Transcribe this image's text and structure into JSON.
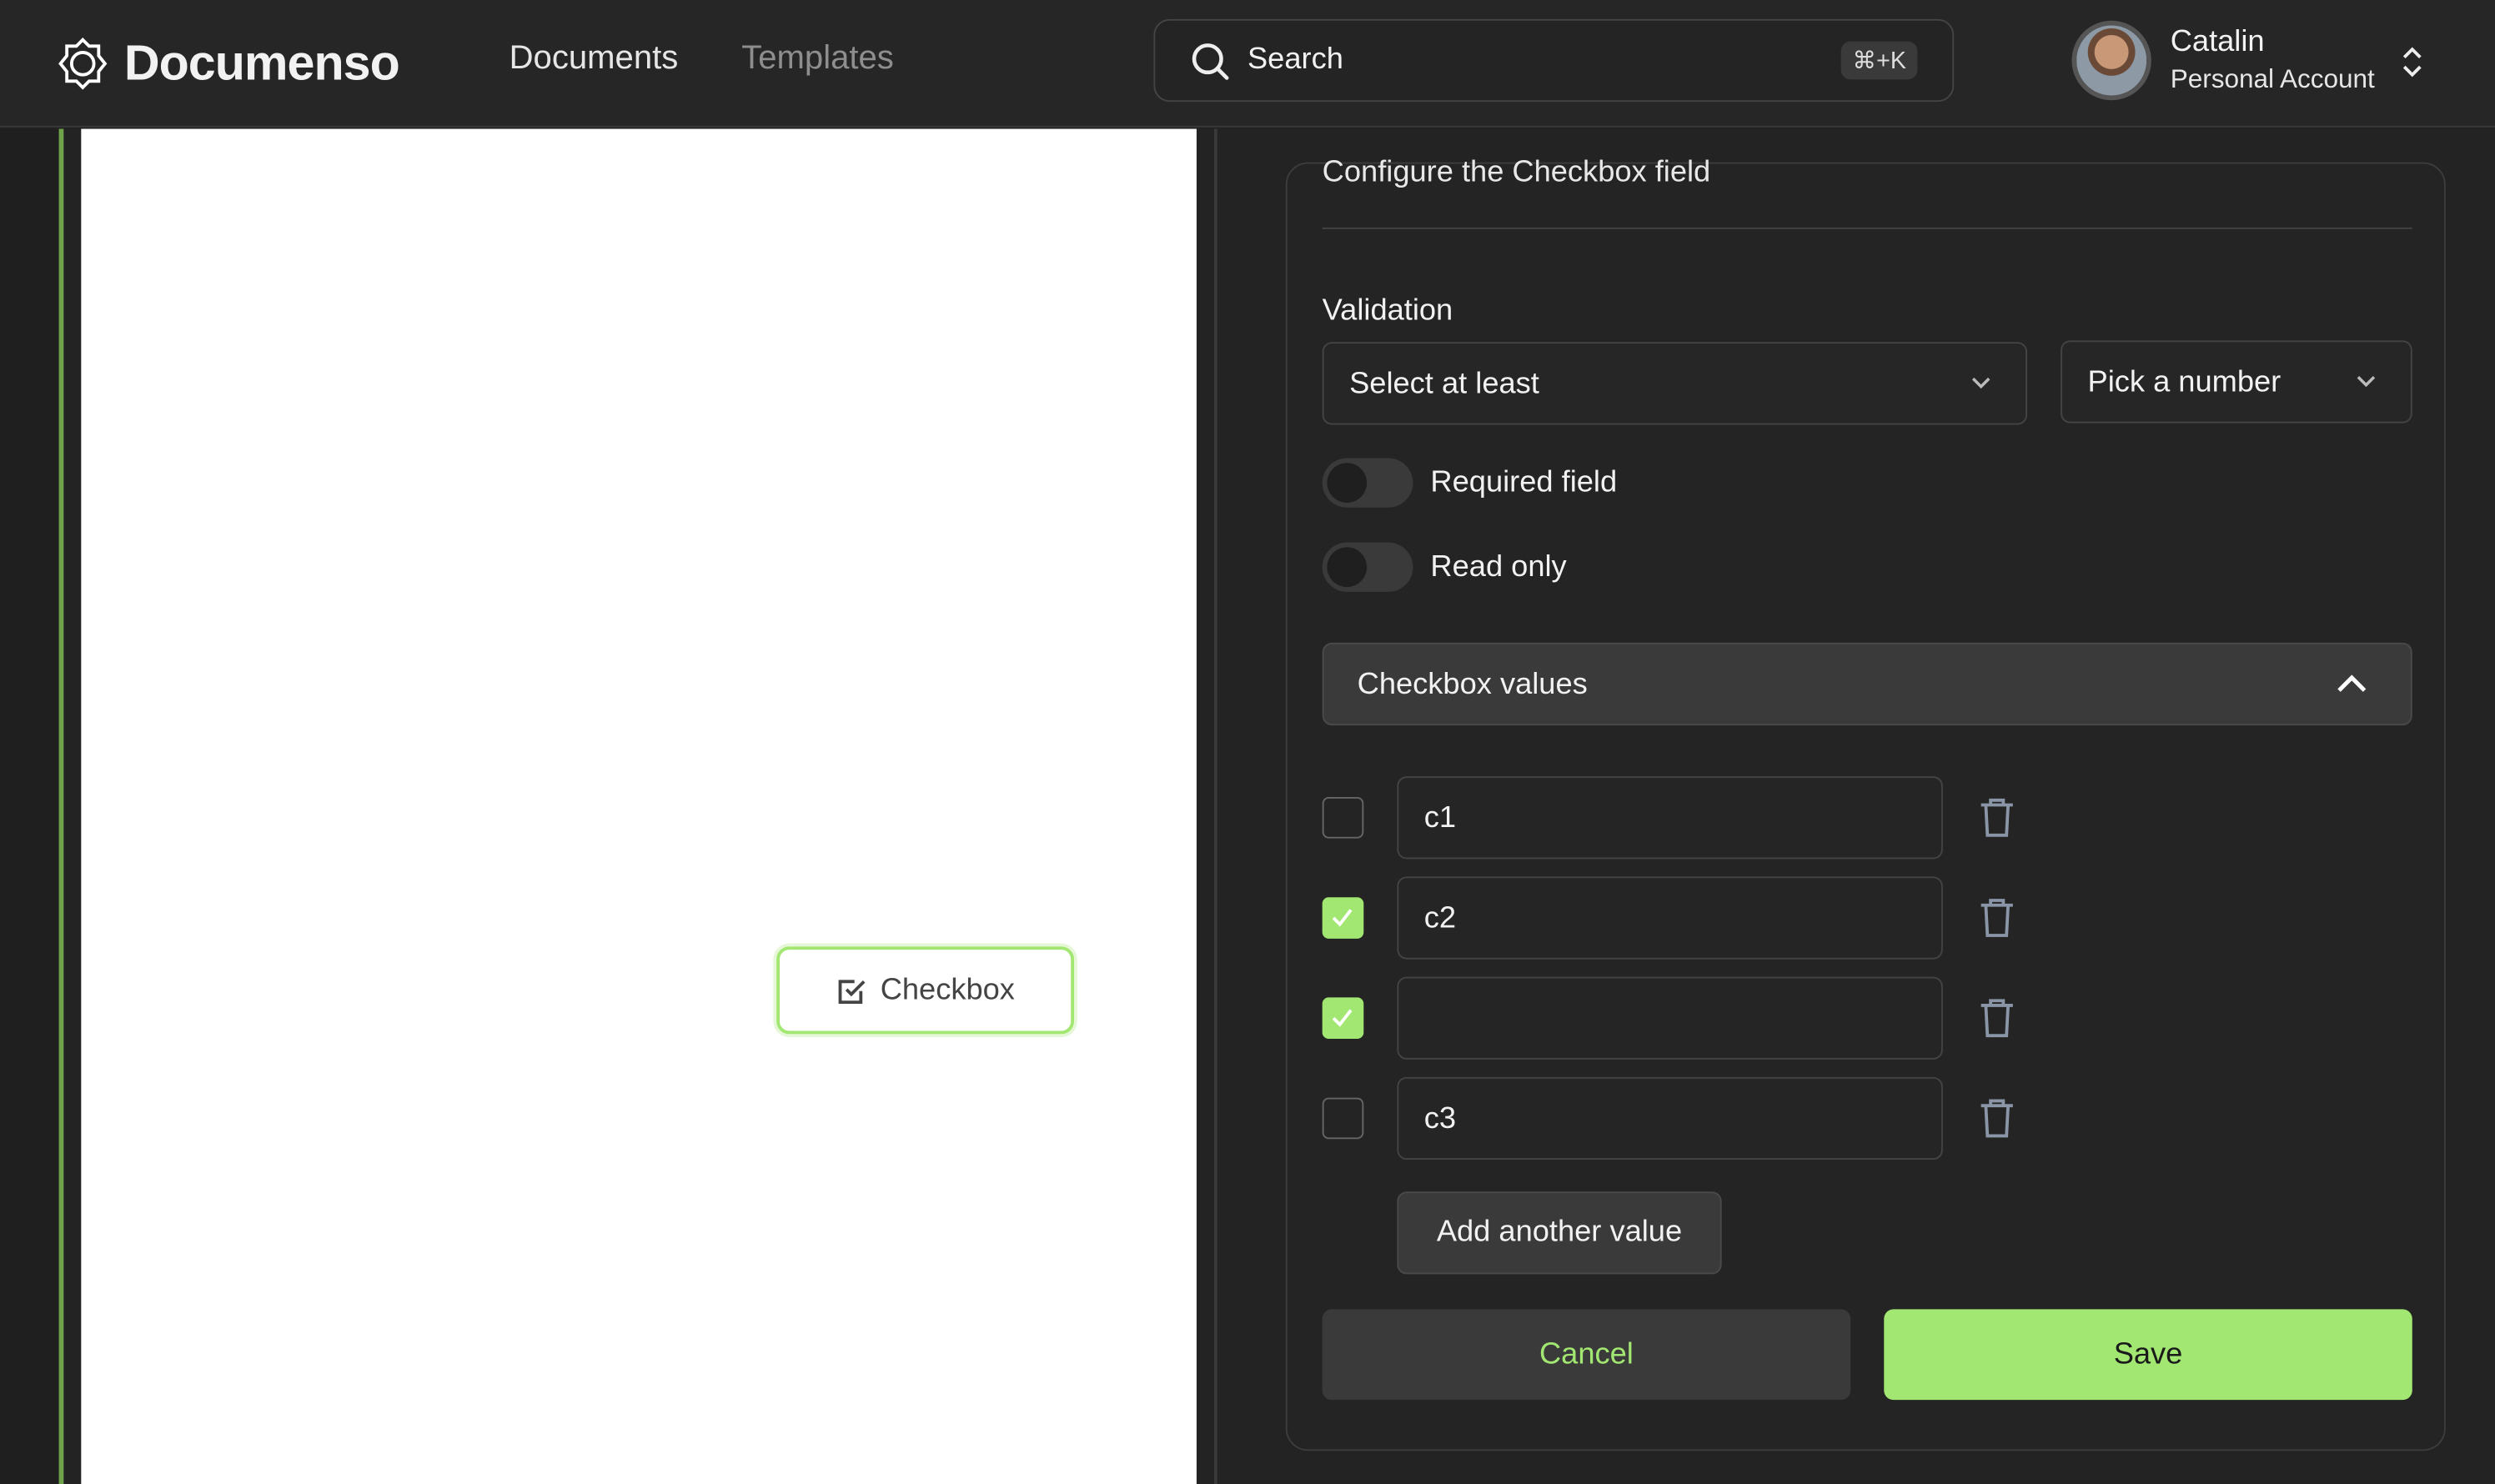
{
  "header": {
    "brand": "Documenso",
    "nav": [
      {
        "label": "Documents"
      },
      {
        "label": "Templates"
      }
    ],
    "search": {
      "label": "Search",
      "shortcut": "⌘+K"
    },
    "user": {
      "name": "Catalin",
      "account": "Personal Account"
    }
  },
  "canvas": {
    "field_label": "Checkbox"
  },
  "panel": {
    "title": "Configure the Checkbox field",
    "validation_label": "Validation",
    "validation_select": "Select at least",
    "number_select": "Pick a number",
    "required_label": "Required field",
    "required_on": false,
    "readonly_label": "Read only",
    "readonly_on": false,
    "values_header": "Checkbox values",
    "values": [
      {
        "value": "c1",
        "checked": false
      },
      {
        "value": "c2",
        "checked": true
      },
      {
        "value": "",
        "checked": true
      },
      {
        "value": "c3",
        "checked": false
      }
    ],
    "add_label": "Add another value",
    "cancel_label": "Cancel",
    "save_label": "Save"
  },
  "colors": {
    "accent": "#a2e771",
    "background": "#232323"
  }
}
